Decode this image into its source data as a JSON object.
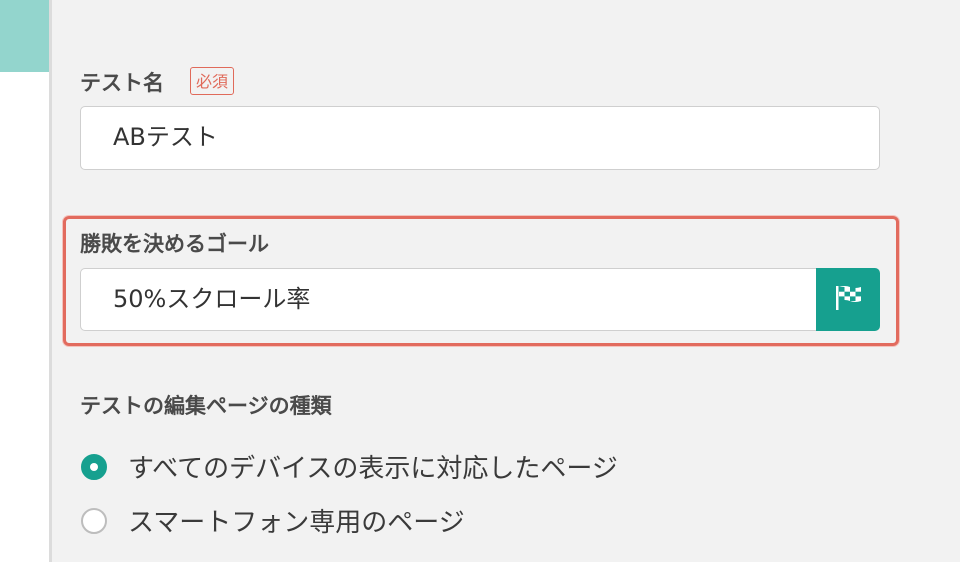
{
  "form": {
    "test_name": {
      "label": "テスト名",
      "required_badge": "必須",
      "value": "ABテスト"
    },
    "goal": {
      "label": "勝敗を決めるゴール",
      "value": "50%スクロール率",
      "button_icon": "checkered-flag-icon"
    },
    "page_type": {
      "label": "テストの編集ページの種類",
      "options": [
        {
          "label": "すべてのデバイスの表示に対応したページ",
          "selected": true
        },
        {
          "label": "スマートフォン専用のページ",
          "selected": false
        }
      ]
    }
  },
  "colors": {
    "accent": "#16a08f",
    "highlight": "#e26b5e",
    "sidebar_accent": "#93d5cd"
  }
}
